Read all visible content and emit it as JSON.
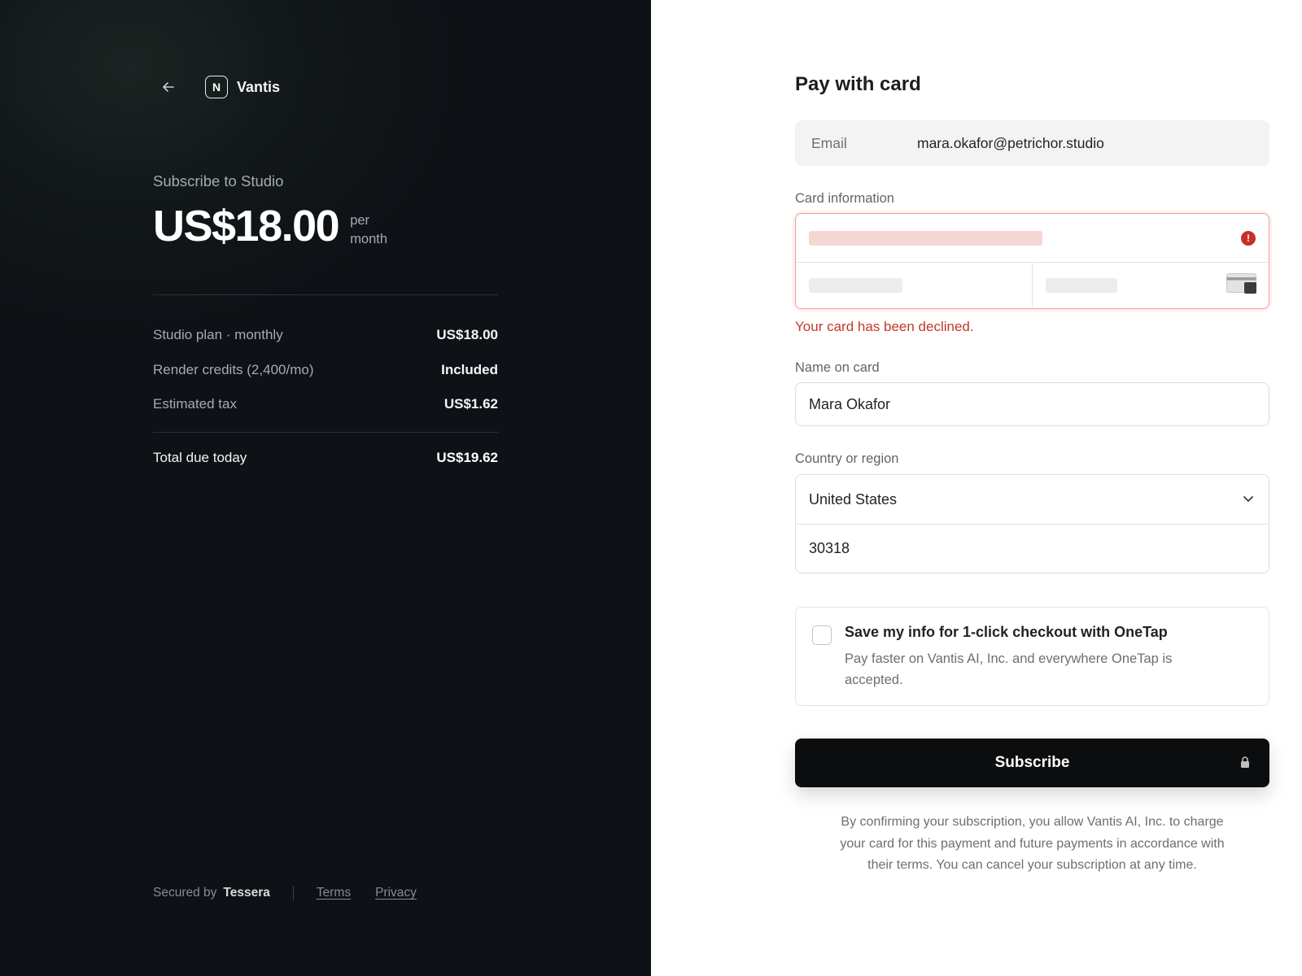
{
  "brand": {
    "name": "Vantis",
    "logo_letter": "N"
  },
  "summary": {
    "title": "Subscribe to Studio",
    "price": "US$18.00",
    "period": "per month",
    "line_items": [
      {
        "label": "Studio plan · monthly",
        "value": "US$18.00"
      },
      {
        "label": "Render credits (2,400/mo)",
        "value": "Included"
      },
      {
        "label": "Estimated tax",
        "value": "US$1.62"
      }
    ],
    "total": {
      "label": "Total due today",
      "value": "US$19.62"
    }
  },
  "footer": {
    "secured_by": "Secured by",
    "provider": "Tessera",
    "terms": "Terms",
    "privacy": "Privacy"
  },
  "form": {
    "title": "Pay with card",
    "email": {
      "label": "Email",
      "value": "mara.okafor@petrichor.studio"
    },
    "card": {
      "label": "Card information",
      "error_icon": "!",
      "error": "Your card has been declined."
    },
    "name": {
      "label": "Name on card",
      "value": "Mara Okafor"
    },
    "country": {
      "label": "Country or region",
      "selected": "United States",
      "zip": "30318"
    },
    "onetap": {
      "title": "Save my info for 1-click checkout with OneTap",
      "description": "Pay faster on Vantis AI, Inc. and everywhere OneTap is accepted.",
      "checked": false
    },
    "submit": "Subscribe",
    "legal": "By confirming your subscription, you allow Vantis AI, Inc. to charge your card for this payment and future payments in accordance with their terms. You can cancel your subscription at any time."
  },
  "colors": {
    "left_bg": "#0e1115",
    "error": "#c0392b",
    "button": "#0c0d0f"
  },
  "icons": [
    "back-arrow-icon",
    "error-icon",
    "card-cvc-icon",
    "chevron-down-icon",
    "lock-icon"
  ]
}
